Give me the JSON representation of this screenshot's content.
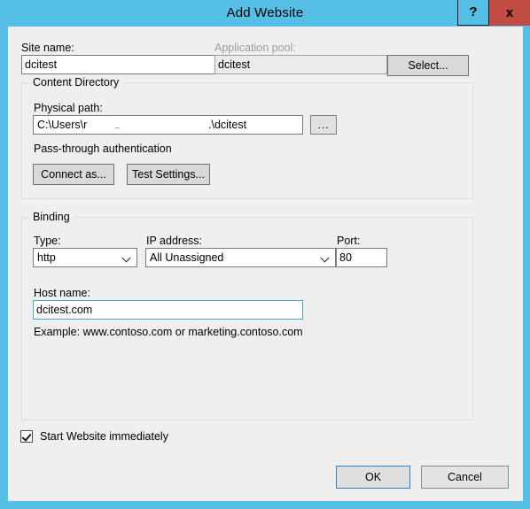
{
  "window": {
    "title": "Add Website",
    "help_button": "?",
    "close_button": "x"
  },
  "site": {
    "name_label": "Site name:",
    "name_value": "dcitest",
    "app_pool_label": "Application pool:",
    "app_pool_value": "dcitest",
    "select_button": "Select..."
  },
  "content_directory": {
    "caption": "Content Directory",
    "physical_path_label": "Physical path:",
    "physical_path_prefix": "C:\\Users\\r",
    "physical_path_suffix": ".\\dcitest",
    "browse_button": "...",
    "auth_text": "Pass-through authentication",
    "connect_as_button": "Connect as...",
    "test_settings_button": "Test Settings..."
  },
  "binding": {
    "caption": "Binding",
    "type_label": "Type:",
    "type_value": "http",
    "ip_label": "IP address:",
    "ip_value": "All Unassigned",
    "port_label": "Port:",
    "port_value": "80",
    "host_label": "Host name:",
    "host_value": "dcitest.com",
    "example_text": "Example: www.contoso.com or marketing.contoso.com"
  },
  "footer": {
    "start_immediately_label": "Start Website immediately",
    "start_immediately_checked": true,
    "ok_button": "OK",
    "cancel_button": "Cancel"
  },
  "colors": {
    "frame": "#55bfe5",
    "close": "#bf4d43",
    "client": "#efefef",
    "focus": "#3da7de",
    "group_border": "#d6dde3"
  }
}
